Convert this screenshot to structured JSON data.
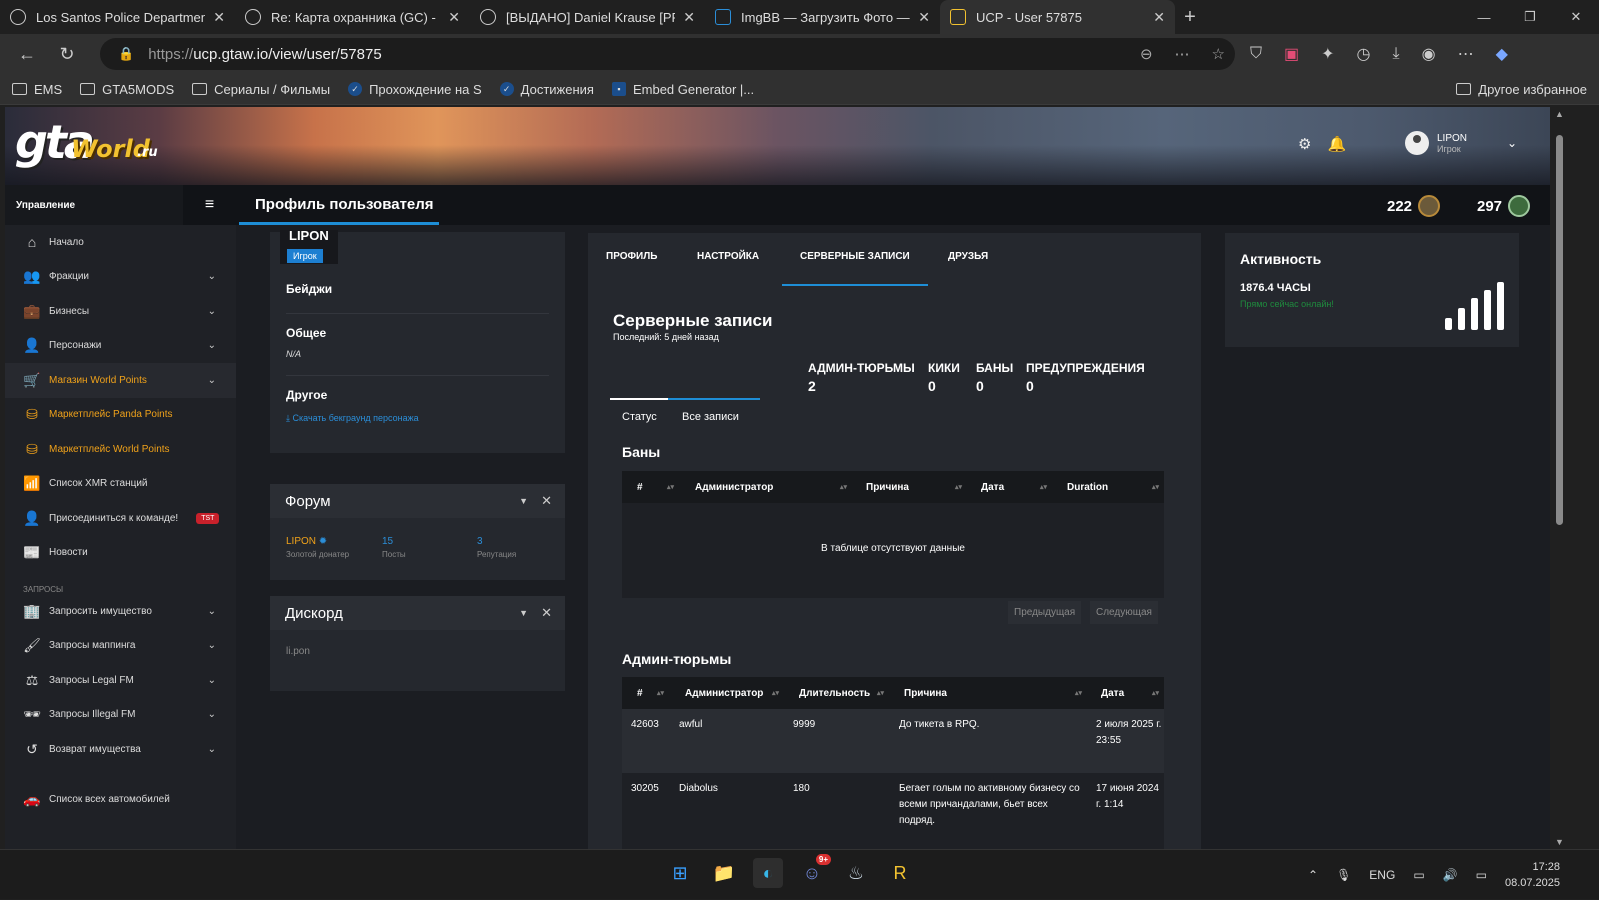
{
  "browser": {
    "tabs": [
      {
        "title": "Los Santos Police Department - H"
      },
      {
        "title": "Re: Карта охранника (GC) - Los S"
      },
      {
        "title": "[ВЫДАНО] Daniel Krause [PF] - Sl"
      },
      {
        "title": "ImgBB — Загрузить Фото — Хос"
      },
      {
        "title": "UCP - User 57875"
      }
    ],
    "url_prefix": "https://",
    "url_main": "ucp.gtaw.io/view/user/57875",
    "bookmarks": [
      "EMS",
      "GTA5MODS",
      "Сериалы / Фильмы",
      "Прохождение на S",
      "Достижения",
      "Embed Generator |..."
    ],
    "bookmarks_other": "Другое избранное"
  },
  "site": {
    "logo_gta": "gta",
    "logo_world": "World",
    "logo_ru": ".ru",
    "user_name": "LIPON",
    "user_role": "Игрок"
  },
  "sidebar": {
    "heading": "Управление",
    "items": [
      {
        "label": "Начало",
        "icon": "home-icon",
        "glyph": "⌂"
      },
      {
        "label": "Фракции",
        "icon": "users-icon",
        "glyph": "👥"
      },
      {
        "label": "Бизнесы",
        "icon": "briefcase-icon",
        "glyph": "💼"
      },
      {
        "label": "Персонажи",
        "icon": "user-icon",
        "glyph": "👤"
      },
      {
        "label": "Магазин World Points",
        "icon": "cart-icon",
        "glyph": "🛒"
      },
      {
        "label": "Маркетплейс Panda Points",
        "icon": "coins-icon",
        "glyph": "⛁"
      },
      {
        "label": "Маркетплейс World Points",
        "icon": "coins-icon",
        "glyph": "⛁"
      },
      {
        "label": "Список XMR станций",
        "icon": "antenna-icon",
        "glyph": "📶"
      },
      {
        "label": "Присоединиться к команде!",
        "icon": "user-plus-icon",
        "glyph": "👤",
        "badge": "TST"
      },
      {
        "label": "Новости",
        "icon": "newspaper-icon",
        "glyph": "📰"
      }
    ],
    "section_requests": "ЗАПРОСЫ",
    "requests": [
      {
        "label": "Запросить имущество",
        "icon": "building-icon",
        "glyph": "🏢"
      },
      {
        "label": "Запросы маппинга",
        "icon": "brush-icon",
        "glyph": "🖌"
      },
      {
        "label": "Запросы Legal FM",
        "icon": "scale-icon",
        "glyph": "⚖"
      },
      {
        "label": "Запросы Illegal FM",
        "icon": "mask-icon",
        "glyph": "🕶"
      },
      {
        "label": "Возврат имущества",
        "icon": "undo-icon",
        "glyph": "↺"
      }
    ],
    "vehicles": {
      "label": "Список всех автомобилей",
      "icon": "car-icon",
      "glyph": "🚗"
    }
  },
  "header": {
    "title": "Профиль пользователя",
    "points_1": "222",
    "points_2": "297"
  },
  "profile": {
    "name": "LIPON",
    "role": "Игрок",
    "badges_label": "Бейджи",
    "general_label": "Общее",
    "general_value": "N/A",
    "other_label": "Другое",
    "download_link": "Скачать бекграунд персонажа"
  },
  "forum": {
    "title": "Форум",
    "user": "LIPON",
    "user_sub": "Золотой донатер",
    "posts_value": "15",
    "posts_label": "Посты",
    "rep_value": "3",
    "rep_label": "Репутация"
  },
  "discord": {
    "title": "Дискорд",
    "value": "li.pon"
  },
  "tabs": [
    "ПРОФИЛЬ",
    "НАСТРОЙКА",
    "СЕРВЕРНЫЕ ЗАПИСИ",
    "ДРУЗЬЯ"
  ],
  "records": {
    "title": "Серверные записи",
    "last": "Последний: 5 дней назад",
    "stats": [
      {
        "label": "АДМИН-ТЮРЬМЫ",
        "value": "2"
      },
      {
        "label": "КИКИ",
        "value": "0"
      },
      {
        "label": "БАНЫ",
        "value": "0"
      },
      {
        "label": "ПРЕДУПРЕЖДЕНИЯ",
        "value": "0"
      }
    ],
    "subtabs": [
      "Статус",
      "Все записи"
    ],
    "bans_title": "Баны",
    "bans_columns": [
      "#",
      "Администратор",
      "Причина",
      "Дата",
      "Duration"
    ],
    "bans_empty": "В таблице отсутствуют данные",
    "prev": "Предыдущая",
    "next": "Следующая",
    "jails_title": "Админ-тюрьмы",
    "jails_columns": [
      "#",
      "Администратор",
      "Длительность",
      "Причина",
      "Дата"
    ],
    "jails": [
      {
        "id": "42603",
        "admin": "awful",
        "duration": "9999",
        "reason": "До тикета в RPQ.",
        "date": "2 июля 2025 г. 23:55"
      },
      {
        "id": "30205",
        "admin": "Diabolus",
        "duration": "180",
        "reason": "Бегает голым по активному бизнесу со всеми причандалами, бьет всех подряд.",
        "date": "17 июня 2024 г. 1:14"
      }
    ]
  },
  "activity": {
    "title": "Активность",
    "hours": "1876.4 ЧАСЫ",
    "online": "Прямо сейчас онлайн!"
  },
  "taskbar": {
    "lang": "ENG",
    "time": "17:28",
    "date": "08.07.2025",
    "discord_badge": "9+"
  }
}
